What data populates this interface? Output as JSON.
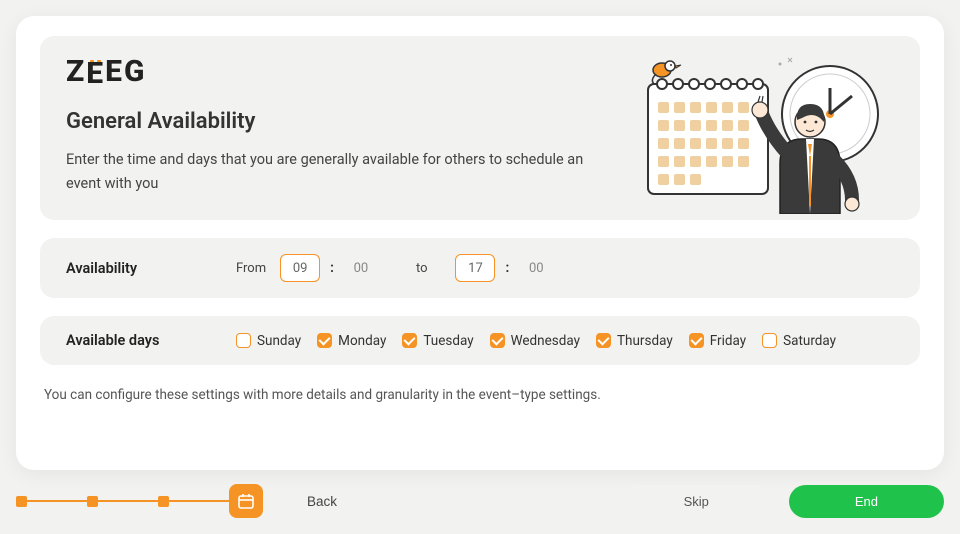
{
  "brand": {
    "name": "ZEEG"
  },
  "header": {
    "title": "General Availability",
    "subtitle": "Enter the time and days that you are generally available for others to schedule an event with you"
  },
  "availability": {
    "label": "Availability",
    "from_label": "From",
    "to_label": "to",
    "from_hour": "09",
    "from_minute": "00",
    "to_hour": "17",
    "to_minute": "00"
  },
  "days": {
    "label": "Available days",
    "items": [
      {
        "name": "Sunday",
        "checked": false
      },
      {
        "name": "Monday",
        "checked": true
      },
      {
        "name": "Tuesday",
        "checked": true
      },
      {
        "name": "Wednesday",
        "checked": true
      },
      {
        "name": "Thursday",
        "checked": true
      },
      {
        "name": "Friday",
        "checked": true
      },
      {
        "name": "Saturday",
        "checked": false
      }
    ]
  },
  "note": "You can configure these settings with more details and granularity in the event–type settings.",
  "nav": {
    "back": "Back",
    "skip": "Skip",
    "end": "End"
  },
  "colors": {
    "accent": "#f59324",
    "primary_action": "#1fc24a"
  }
}
